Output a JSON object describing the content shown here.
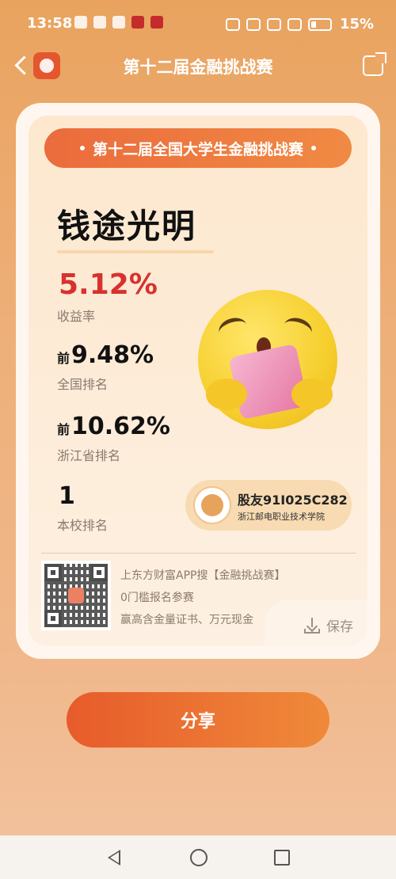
{
  "status_bar": {
    "time": "13:58",
    "battery": "15%"
  },
  "header": {
    "title": "第十二届金融挑战赛"
  },
  "card": {
    "banner": "第十二届全国大学生金融挑战赛",
    "nickname": "钱途光明",
    "stats": [
      {
        "prefix": "",
        "value": "5.12%",
        "label": "收益率"
      },
      {
        "prefix": "前",
        "value": "9.48%",
        "label": "全国排名"
      },
      {
        "prefix": "前",
        "value": "10.62%",
        "label": "浙江省排名"
      },
      {
        "prefix": "",
        "value": "1",
        "label": "本校排名"
      }
    ],
    "user": {
      "name": "股友91I025C282",
      "school": "浙江邮电职业技术学院"
    },
    "promo": [
      "上东方财富APP搜【金融挑战赛】",
      "0门槛报名参赛",
      "赢高含金量证书、万元现金"
    ],
    "save_label": "保存"
  },
  "share_button": "分享",
  "colors": {
    "accent": "#ec6a32",
    "highlight": "#d8322e",
    "background": "#eca868"
  }
}
